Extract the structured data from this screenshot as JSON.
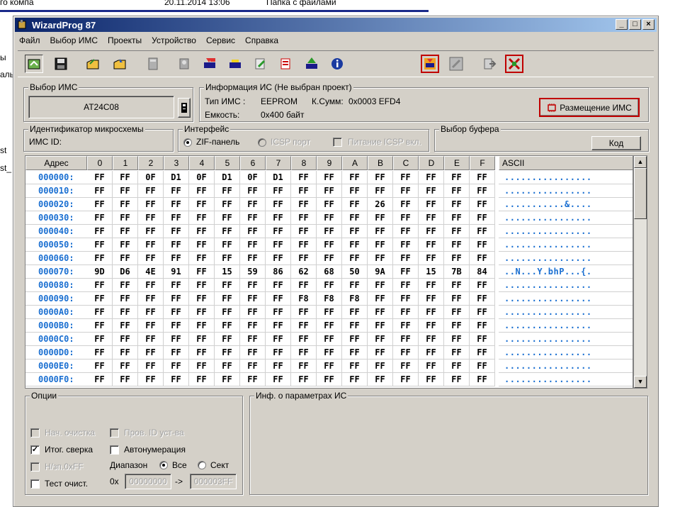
{
  "background": {
    "top_items": [
      "го компа",
      "20.11.2014 13:06",
      "Папка с файлами"
    ],
    "left_items": [
      "ы",
      "аль",
      "st",
      "st_"
    ]
  },
  "window": {
    "title": "WizardProg 87",
    "buttons": [
      "_",
      "□",
      "×"
    ]
  },
  "menu": [
    "Файл",
    "Выбор ИМС",
    "Проекты",
    "Устройство",
    "Сервис",
    "Справка"
  ],
  "toolbar_icons": [
    "open-file-icon",
    "save-icon",
    "open-project-icon",
    "save-project-icon",
    "calculator-icon",
    "chip-socket-icon",
    "read-chip-icon",
    "erase-chip-icon",
    "write-chip-icon",
    "verify-chip-icon",
    "program-chip-icon",
    "info-icon",
    "auto-program-icon",
    "blank-check-icon",
    "export-icon",
    "reset-icon"
  ],
  "chip_select": {
    "label": "Выбор ИМС",
    "value": "AT24C08"
  },
  "chip_info": {
    "label": "Информация ИС (Не выбран проект)",
    "type_label": "Тип ИМС :",
    "type_value": "EEPROM",
    "checksum_label": "К.Сумм:",
    "checksum_value": "0x0003 EFD4",
    "capacity_label": "Емкость:",
    "capacity_value": "0x400 байт",
    "placement_button": "Размещение ИМС"
  },
  "chip_id": {
    "label": "Идентификатор микросхемы",
    "field_label": "ИМС ID:"
  },
  "interface": {
    "label": "Интерфейс",
    "zif": "ZIF-панель",
    "icsp": "ICSP порт",
    "icsp_power": "Питание ICSP вкл."
  },
  "buffer": {
    "label": "Выбор буфера",
    "button": "Код"
  },
  "hex": {
    "addr_header": "Адрес",
    "columns": [
      "0",
      "1",
      "2",
      "3",
      "4",
      "5",
      "6",
      "7",
      "8",
      "9",
      "A",
      "B",
      "C",
      "D",
      "E",
      "F"
    ],
    "ascii_header": "ASCII",
    "rows": [
      {
        "addr": "000000:",
        "bytes": [
          "FF",
          "FF",
          "0F",
          "D1",
          "0F",
          "D1",
          "0F",
          "D1",
          "FF",
          "FF",
          "FF",
          "FF",
          "FF",
          "FF",
          "FF",
          "FF"
        ],
        "ascii": "................"
      },
      {
        "addr": "000010:",
        "bytes": [
          "FF",
          "FF",
          "FF",
          "FF",
          "FF",
          "FF",
          "FF",
          "FF",
          "FF",
          "FF",
          "FF",
          "FF",
          "FF",
          "FF",
          "FF",
          "FF"
        ],
        "ascii": "................"
      },
      {
        "addr": "000020:",
        "bytes": [
          "FF",
          "FF",
          "FF",
          "FF",
          "FF",
          "FF",
          "FF",
          "FF",
          "FF",
          "FF",
          "FF",
          "26",
          "FF",
          "FF",
          "FF",
          "FF"
        ],
        "ascii": "...........&...."
      },
      {
        "addr": "000030:",
        "bytes": [
          "FF",
          "FF",
          "FF",
          "FF",
          "FF",
          "FF",
          "FF",
          "FF",
          "FF",
          "FF",
          "FF",
          "FF",
          "FF",
          "FF",
          "FF",
          "FF"
        ],
        "ascii": "................"
      },
      {
        "addr": "000040:",
        "bytes": [
          "FF",
          "FF",
          "FF",
          "FF",
          "FF",
          "FF",
          "FF",
          "FF",
          "FF",
          "FF",
          "FF",
          "FF",
          "FF",
          "FF",
          "FF",
          "FF"
        ],
        "ascii": "................"
      },
      {
        "addr": "000050:",
        "bytes": [
          "FF",
          "FF",
          "FF",
          "FF",
          "FF",
          "FF",
          "FF",
          "FF",
          "FF",
          "FF",
          "FF",
          "FF",
          "FF",
          "FF",
          "FF",
          "FF"
        ],
        "ascii": "................"
      },
      {
        "addr": "000060:",
        "bytes": [
          "FF",
          "FF",
          "FF",
          "FF",
          "FF",
          "FF",
          "FF",
          "FF",
          "FF",
          "FF",
          "FF",
          "FF",
          "FF",
          "FF",
          "FF",
          "FF"
        ],
        "ascii": "................"
      },
      {
        "addr": "000070:",
        "bytes": [
          "9D",
          "D6",
          "4E",
          "91",
          "FF",
          "15",
          "59",
          "86",
          "62",
          "68",
          "50",
          "9A",
          "FF",
          "15",
          "7B",
          "84"
        ],
        "ascii": "..N...Y.bhP...{."
      },
      {
        "addr": "000080:",
        "bytes": [
          "FF",
          "FF",
          "FF",
          "FF",
          "FF",
          "FF",
          "FF",
          "FF",
          "FF",
          "FF",
          "FF",
          "FF",
          "FF",
          "FF",
          "FF",
          "FF"
        ],
        "ascii": "................"
      },
      {
        "addr": "000090:",
        "bytes": [
          "FF",
          "FF",
          "FF",
          "FF",
          "FF",
          "FF",
          "FF",
          "FF",
          "F8",
          "F8",
          "F8",
          "FF",
          "FF",
          "FF",
          "FF",
          "FF"
        ],
        "ascii": "................"
      },
      {
        "addr": "0000A0:",
        "bytes": [
          "FF",
          "FF",
          "FF",
          "FF",
          "FF",
          "FF",
          "FF",
          "FF",
          "FF",
          "FF",
          "FF",
          "FF",
          "FF",
          "FF",
          "FF",
          "FF"
        ],
        "ascii": "................"
      },
      {
        "addr": "0000B0:",
        "bytes": [
          "FF",
          "FF",
          "FF",
          "FF",
          "FF",
          "FF",
          "FF",
          "FF",
          "FF",
          "FF",
          "FF",
          "FF",
          "FF",
          "FF",
          "FF",
          "FF"
        ],
        "ascii": "................"
      },
      {
        "addr": "0000C0:",
        "bytes": [
          "FF",
          "FF",
          "FF",
          "FF",
          "FF",
          "FF",
          "FF",
          "FF",
          "FF",
          "FF",
          "FF",
          "FF",
          "FF",
          "FF",
          "FF",
          "FF"
        ],
        "ascii": "................"
      },
      {
        "addr": "0000D0:",
        "bytes": [
          "FF",
          "FF",
          "FF",
          "FF",
          "FF",
          "FF",
          "FF",
          "FF",
          "FF",
          "FF",
          "FF",
          "FF",
          "FF",
          "FF",
          "FF",
          "FF"
        ],
        "ascii": "................"
      },
      {
        "addr": "0000E0:",
        "bytes": [
          "FF",
          "FF",
          "FF",
          "FF",
          "FF",
          "FF",
          "FF",
          "FF",
          "FF",
          "FF",
          "FF",
          "FF",
          "FF",
          "FF",
          "FF",
          "FF"
        ],
        "ascii": "................"
      },
      {
        "addr": "0000F0:",
        "bytes": [
          "FF",
          "FF",
          "FF",
          "FF",
          "FF",
          "FF",
          "FF",
          "FF",
          "FF",
          "FF",
          "FF",
          "FF",
          "FF",
          "FF",
          "FF",
          "FF"
        ],
        "ascii": "................"
      }
    ]
  },
  "options": {
    "label": "Опции",
    "erase": "Нач. очистка",
    "check_id": "Пров. ID уст-ва",
    "final_verify": "Итог. сверка",
    "auto_number": "Автонумерация",
    "blank_check": "Н/зп.0xFF",
    "test_clear": "Тест очист.",
    "range_label": "Диапазон",
    "range_all": "Все",
    "range_sect": "Сект",
    "range_prefix": "0x",
    "range_from": "00000000",
    "range_arrow": "->",
    "range_to": "000003FF"
  },
  "params": {
    "label": "Инф. о параметрах ИС"
  },
  "colors": {
    "accent": "#1a6fd1",
    "title_start": "#0a246a",
    "title_end": "#a6caf0",
    "face": "#d4d0c8",
    "danger": "#c00000"
  }
}
